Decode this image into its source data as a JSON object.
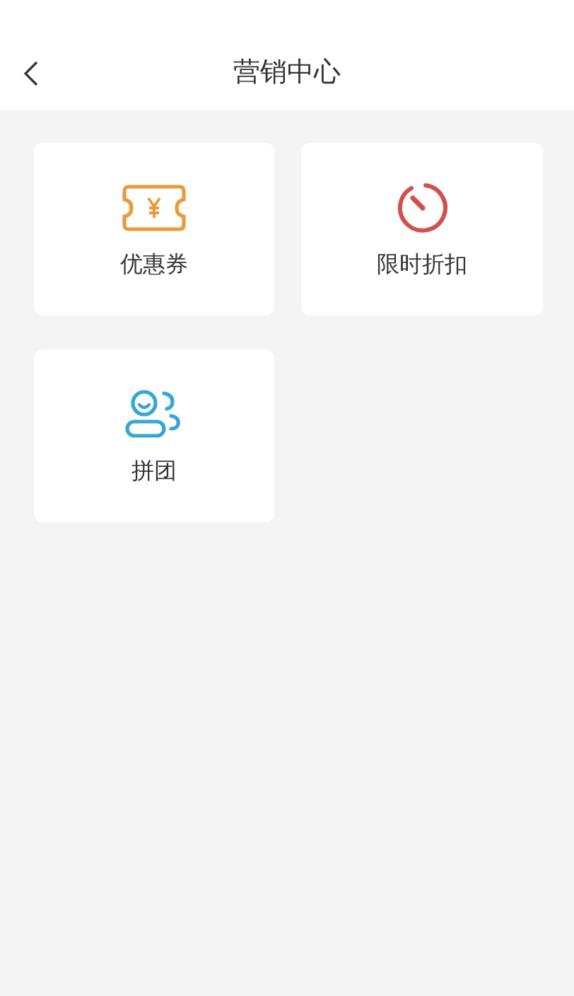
{
  "header": {
    "title": "营销中心"
  },
  "items": [
    {
      "kind": "coupon",
      "label": "优惠券"
    },
    {
      "kind": "timer",
      "label": "限时折扣"
    },
    {
      "kind": "group",
      "label": "拼团"
    }
  ]
}
